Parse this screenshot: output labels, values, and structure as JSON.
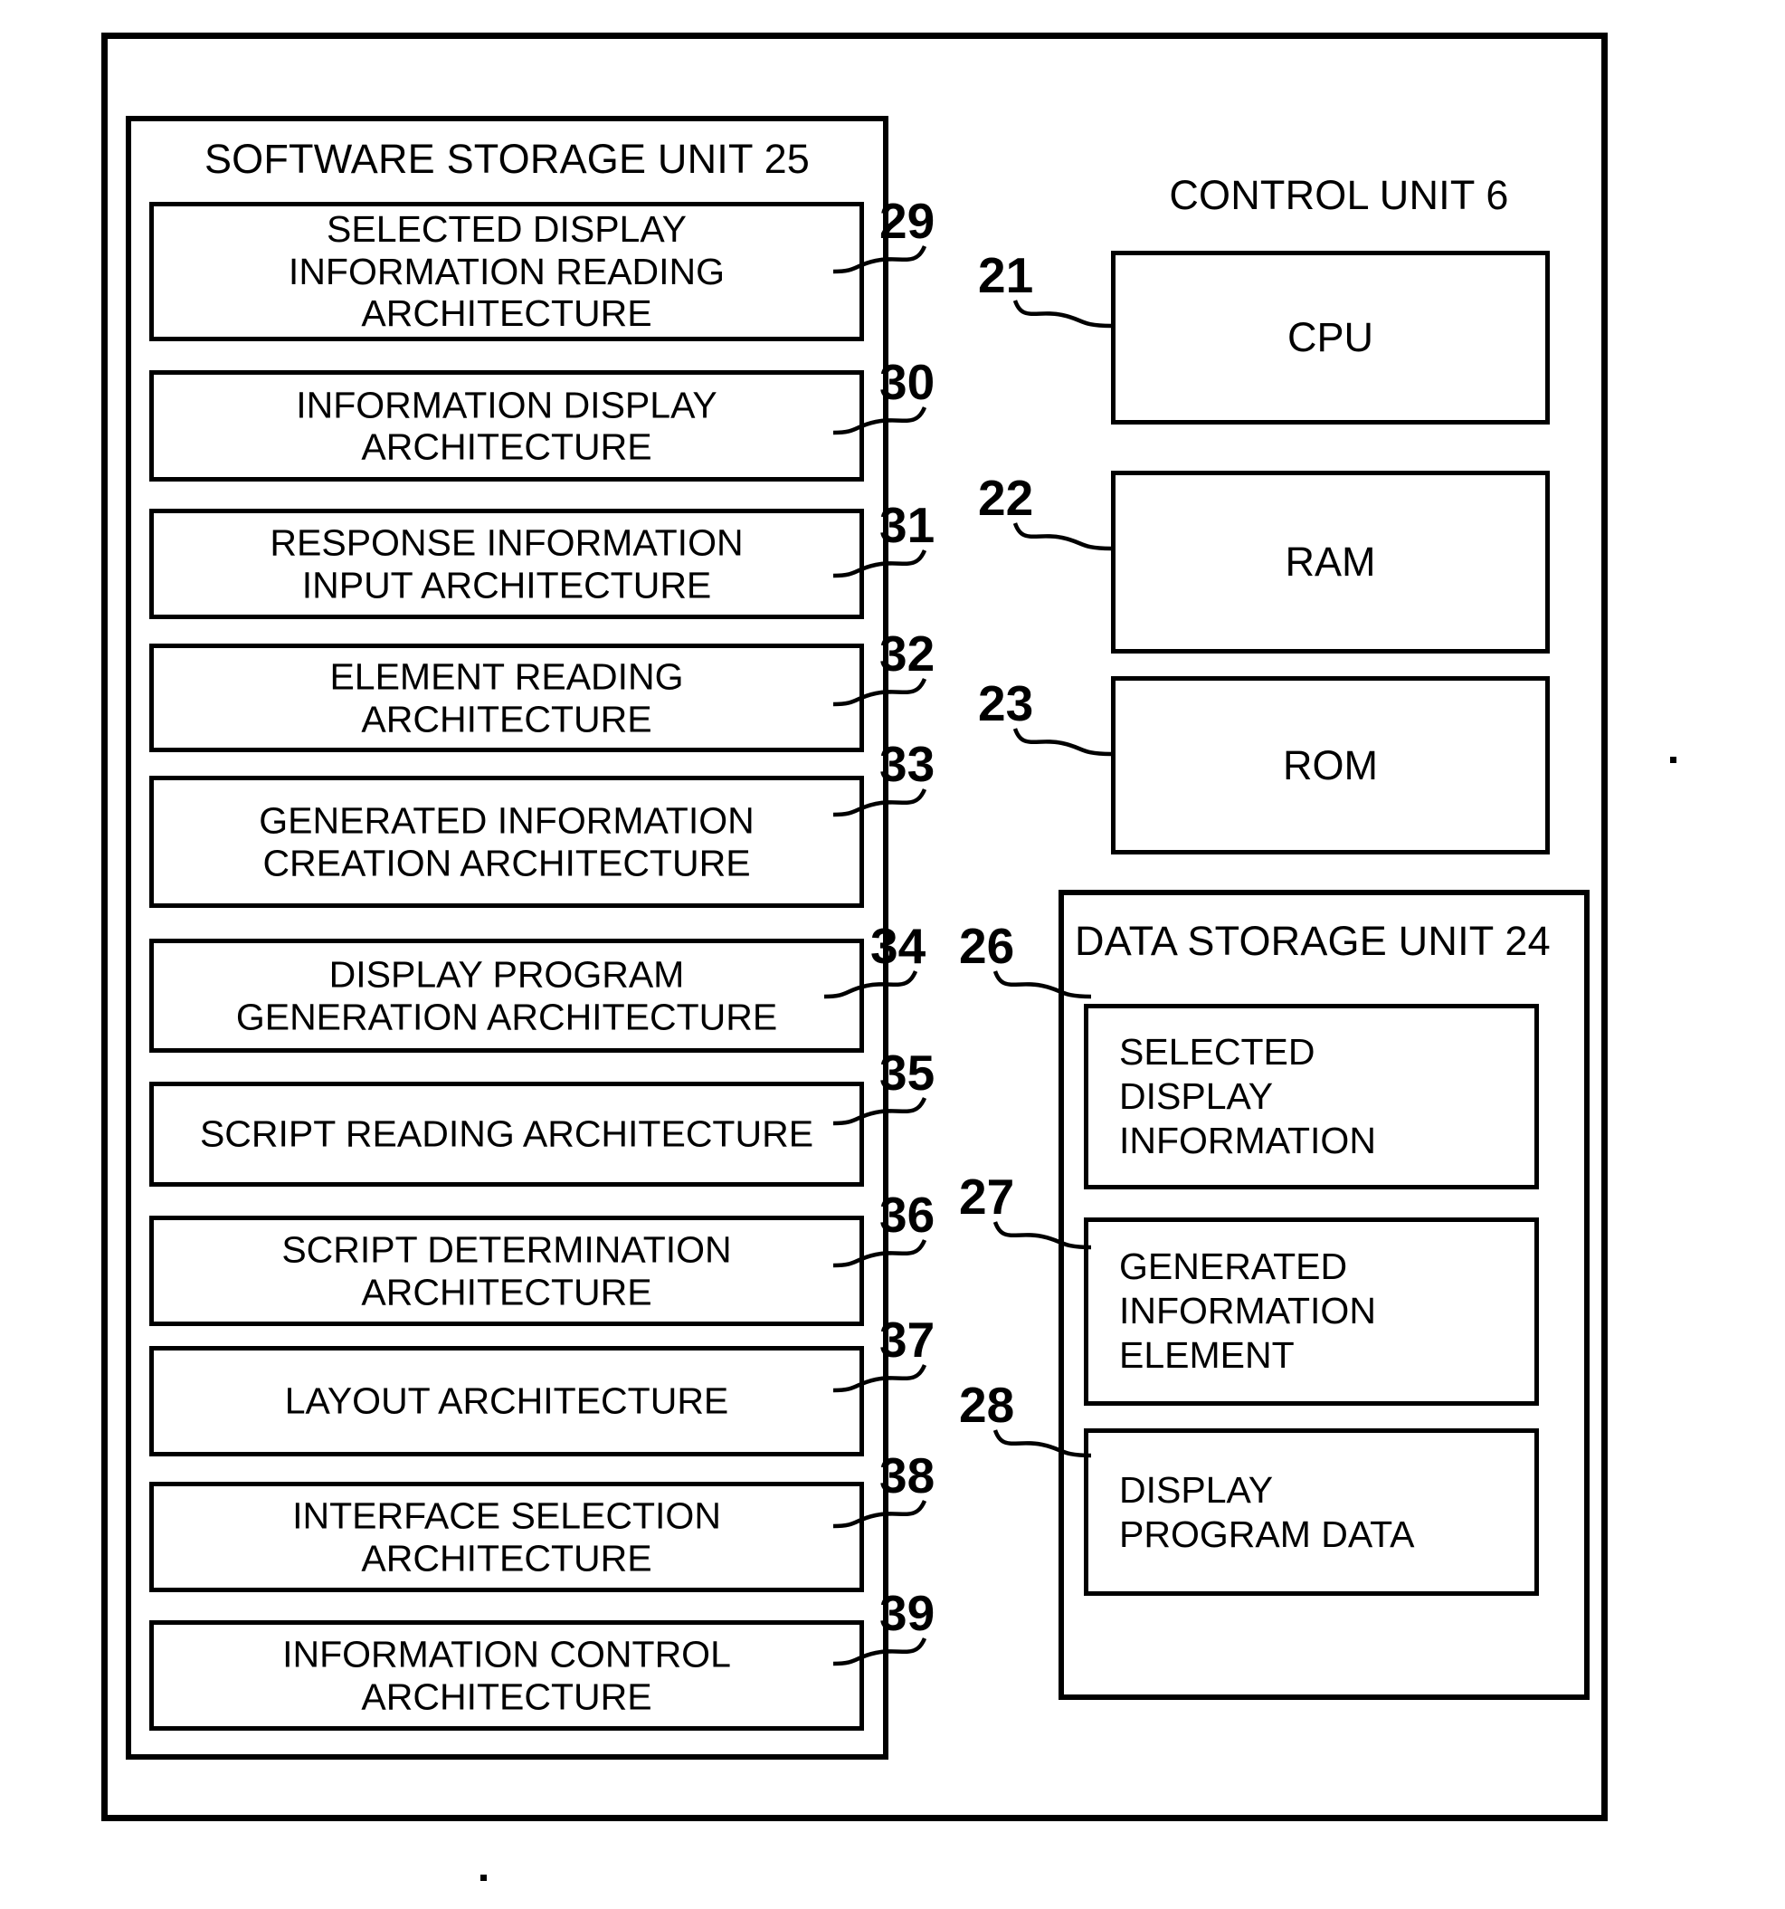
{
  "figure": {
    "software_storage": {
      "title": "SOFTWARE STORAGE UNIT 25",
      "modules": [
        {
          "ref": "29",
          "label": "SELECTED DISPLAY\nINFORMATION READING\nARCHITECTURE"
        },
        {
          "ref": "30",
          "label": "INFORMATION DISPLAY\nARCHITECTURE"
        },
        {
          "ref": "31",
          "label": "RESPONSE INFORMATION\nINPUT ARCHITECTURE"
        },
        {
          "ref": "32",
          "label": "ELEMENT READING\nARCHITECTURE"
        },
        {
          "ref": "33",
          "label": "GENERATED INFORMATION\nCREATION ARCHITECTURE"
        },
        {
          "ref": "34",
          "label": "DISPLAY PROGRAM\nGENERATION ARCHITECTURE"
        },
        {
          "ref": "35",
          "label": "SCRIPT READING ARCHITECTURE"
        },
        {
          "ref": "36",
          "label": "SCRIPT DETERMINATION\nARCHITECTURE"
        },
        {
          "ref": "37",
          "label": "LAYOUT ARCHITECTURE"
        },
        {
          "ref": "38",
          "label": "INTERFACE SELECTION\nARCHITECTURE"
        },
        {
          "ref": "39",
          "label": "INFORMATION CONTROL\nARCHITECTURE"
        }
      ]
    },
    "control_unit": {
      "title": "CONTROL UNIT 6",
      "chips": [
        {
          "ref": "21",
          "label": "CPU"
        },
        {
          "ref": "22",
          "label": "RAM"
        },
        {
          "ref": "23",
          "label": "ROM"
        }
      ]
    },
    "data_storage": {
      "title": "DATA STORAGE UNIT 24",
      "ref": "26",
      "items": [
        {
          "ref": "26",
          "label": "SELECTED\nDISPLAY\nINFORMATION"
        },
        {
          "ref": "27",
          "label": "GENERATED\nINFORMATION\nELEMENT"
        },
        {
          "ref": "28",
          "label": "DISPLAY\nPROGRAM DATA"
        }
      ]
    }
  }
}
